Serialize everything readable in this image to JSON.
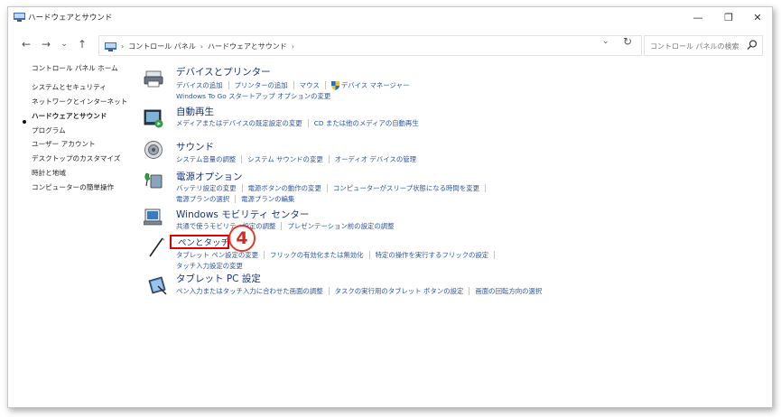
{
  "window": {
    "title": "ハードウェアとサウンド",
    "minimize": "—",
    "maximize": "❐",
    "close": "✕"
  },
  "nav": {
    "back": "←",
    "forward": "→",
    "dropdown": "⌄",
    "up": "↑"
  },
  "address": {
    "crumbs": [
      "コントロール パネル",
      "ハードウェアとサウンド"
    ],
    "separator": "›",
    "dropdown": "⌄",
    "refresh": "↻"
  },
  "search": {
    "placeholder": "コントロール パネルの検索"
  },
  "sidebar": {
    "items": [
      {
        "label": "コントロール パネル ホーム"
      },
      {
        "label": "システムとセキュリティ"
      },
      {
        "label": "ネットワークとインターネット"
      },
      {
        "label": "ハードウェアとサウンド"
      },
      {
        "label": "プログラム"
      },
      {
        "label": "ユーザー アカウント"
      },
      {
        "label": "デスクトップのカスタマイズ"
      },
      {
        "label": "時計と地域"
      },
      {
        "label": "コンピューターの簡単操作"
      }
    ]
  },
  "categories": [
    {
      "title": "デバイスとプリンター",
      "links": [
        [
          "デバイスの追加",
          "プリンターの追加",
          "マウス",
          "デバイス マネージャー"
        ],
        [
          "Windows To Go スタートアップ オプションの変更"
        ]
      ]
    },
    {
      "title": "自動再生",
      "links": [
        [
          "メディアまたはデバイスの既定設定の変更",
          "CD または他のメディアの自動再生"
        ]
      ]
    },
    {
      "title": "サウンド",
      "links": [
        [
          "システム音量の調整",
          "システム サウンドの変更",
          "オーディオ デバイスの管理"
        ]
      ]
    },
    {
      "title": "電源オプション",
      "links": [
        [
          "バッテリ設定の変更",
          "電源ボタンの動作の変更",
          "コンピューターがスリープ状態になる時間を変更"
        ],
        [
          "電源プランの選択",
          "電源プランの編集"
        ]
      ]
    },
    {
      "title": "Windows モビリティ センター",
      "links": [
        [
          "共通で使うモビリティ設定の調整",
          "プレゼンテーション前の設定の調整"
        ]
      ]
    },
    {
      "title": "ペンとタッチ",
      "links": [
        [
          "タブレット ペン設定の変更",
          "フリックの有効化または無効化",
          "特定の操作を実行するフリックの設定"
        ],
        [
          "タッチ入力設定の変更"
        ]
      ]
    },
    {
      "title": "タブレット PC 設定",
      "links": [
        [
          "ペン入力またはタッチ入力に合わせた画面の調整",
          "タスクの実行用のタブレット ボタンの設定",
          "画面の回転方向の選択"
        ]
      ]
    }
  ],
  "annotation": {
    "step": "4"
  },
  "colors": {
    "accent_title": "#17347b",
    "link": "#2a55a5",
    "highlight": "#e00000"
  }
}
